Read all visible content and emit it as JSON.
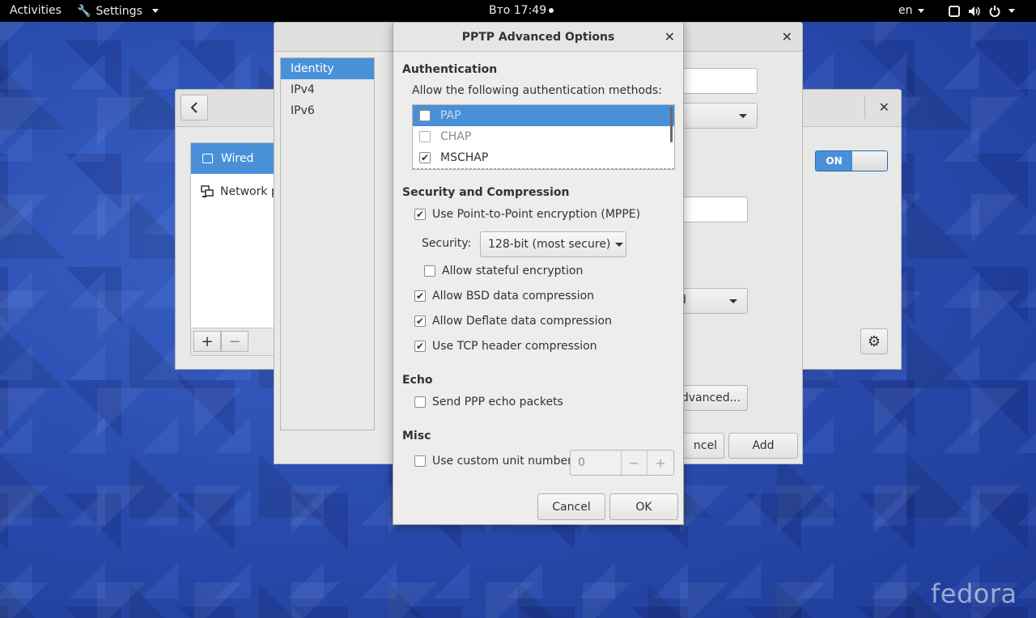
{
  "topbar": {
    "activities": "Activities",
    "app_name": "Settings",
    "clock": "Вто 17:49",
    "language": "en"
  },
  "network_window": {
    "devices": [
      {
        "label": "Wired"
      },
      {
        "label": "Network p"
      }
    ],
    "toggle": "ON"
  },
  "vpn_window": {
    "sidebar": [
      "Identity",
      "IPv4",
      "IPv6"
    ],
    "partial_combo": "d",
    "advanced_button": "Advanced...",
    "cancel_button": "ncel",
    "add_button": "Add"
  },
  "dialog": {
    "title": "PPTP Advanced Options",
    "authentication": {
      "heading": "Authentication",
      "prompt": "Allow the following authentication methods:",
      "methods": [
        {
          "label": "PAP",
          "checked": false
        },
        {
          "label": "CHAP",
          "checked": false
        },
        {
          "label": "MSCHAP",
          "checked": true
        }
      ]
    },
    "security": {
      "heading": "Security and Compression",
      "mppe_label": "Use Point-to-Point encryption (MPPE)",
      "security_label": "Security:",
      "security_value": "128-bit (most secure)",
      "stateful_label": "Allow stateful encryption",
      "bsd_label": "Allow BSD data compression",
      "deflate_label": "Allow Deflate data compression",
      "tcp_label": "Use TCP header compression"
    },
    "echo": {
      "heading": "Echo",
      "send_label": "Send PPP echo packets"
    },
    "misc": {
      "heading": "Misc",
      "unit_label": "Use custom unit number:",
      "unit_value": "0"
    },
    "cancel": "Cancel",
    "ok": "OK"
  },
  "watermark": "fedora"
}
